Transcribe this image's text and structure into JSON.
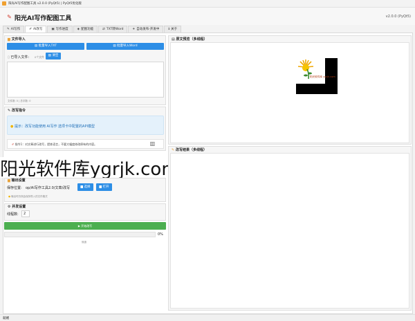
{
  "titlebar": {
    "title": "阳光AI写作配图工具 v2.0.0 (PyQt5) | PyQt5优化版"
  },
  "header": {
    "title": "阳光AI写作配图工具",
    "version": "v2.0.0 (PyQt5)"
  },
  "tabs": [
    {
      "icon": "✎",
      "label": "AI写作"
    },
    {
      "icon": "✐",
      "label": "AI改写"
    },
    {
      "icon": "▣",
      "label": "写作进度"
    },
    {
      "icon": "◈",
      "label": "配图功能"
    },
    {
      "icon": "⇄",
      "label": "TXT转Word"
    },
    {
      "icon": "✈",
      "label": "自动发布-开发中"
    },
    {
      "icon": "ℹ",
      "label": "关于"
    }
  ],
  "file_import": {
    "title": "文件导入",
    "btn_txt": "批量导入TXT",
    "btn_word": "批量导入Word",
    "imported_label": "已导入文件:",
    "imported_value": "0个文件",
    "clear_btn": "清空",
    "footer": "文件数: 0 | 总字数: 0"
  },
  "rewrite": {
    "title": "改写指令",
    "hint": "提示：改写功能使用 AI写作 选项卡中配置的API模型",
    "cmd_label": "指令1：对文章进行改写，提炼语言，不要大幅度修改原有的内容。"
  },
  "output": {
    "title": "输出设置",
    "path_label": "保存位置:",
    "path_value": "op/AI写作工具2.0/文章/改写",
    "browse_btn": "选择",
    "open_btn": "打开",
    "note": "输出时仍然会保持导入的文件格式"
  },
  "concurrency": {
    "title": "并发设置",
    "threads_label": "线程数:",
    "threads_value": "2",
    "start_btn": "开始改写",
    "progress": "0%",
    "status": "就绪"
  },
  "preview": {
    "title": "原文预览（多线程）"
  },
  "result": {
    "title": "改写结果（多线程）"
  },
  "logo_text": "阳光软件库 ygrjk.com",
  "watermark": "阳光软件库ygrjk.com",
  "statusbar": "就绪",
  "colors": {
    "accent": "#2d8ee6",
    "start": "#4caf50",
    "hint_bg": "#e4f1fb"
  }
}
